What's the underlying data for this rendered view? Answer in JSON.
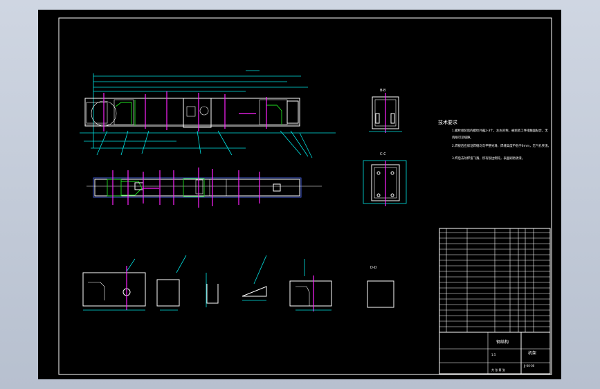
{
  "drawing": {
    "tech_requirements_title": "技术要求",
    "tech_requirements": [
      "1.螺栓组装后的螺纹外露2-3个，左右对称，被组装工件接触面贴合，无",
      "肉眼可见缝隙。",
      "2.焊接后应保证焊缝均匀平整光滑，焊缝高度不低于6mm，无气孔夹渣。",
      "3.焊后去除焊渣飞溅，所有锐边倒钝，表面刷防锈漆。"
    ],
    "section_labels": [
      "B-B",
      "C-C",
      "D-D"
    ],
    "title_block": {
      "part_name": "钢结构",
      "drawing_name": "机架",
      "drawing_number": "JJ-00-00",
      "scale": "1:5",
      "sheet": "共 张 第 张"
    }
  },
  "colors": {
    "background": "#000000",
    "frame": "#ffffff",
    "dimension": "#00e6e6",
    "centerline": "#ff22ff",
    "hidden": "#1fe01f",
    "outline": "#4a6bff"
  }
}
